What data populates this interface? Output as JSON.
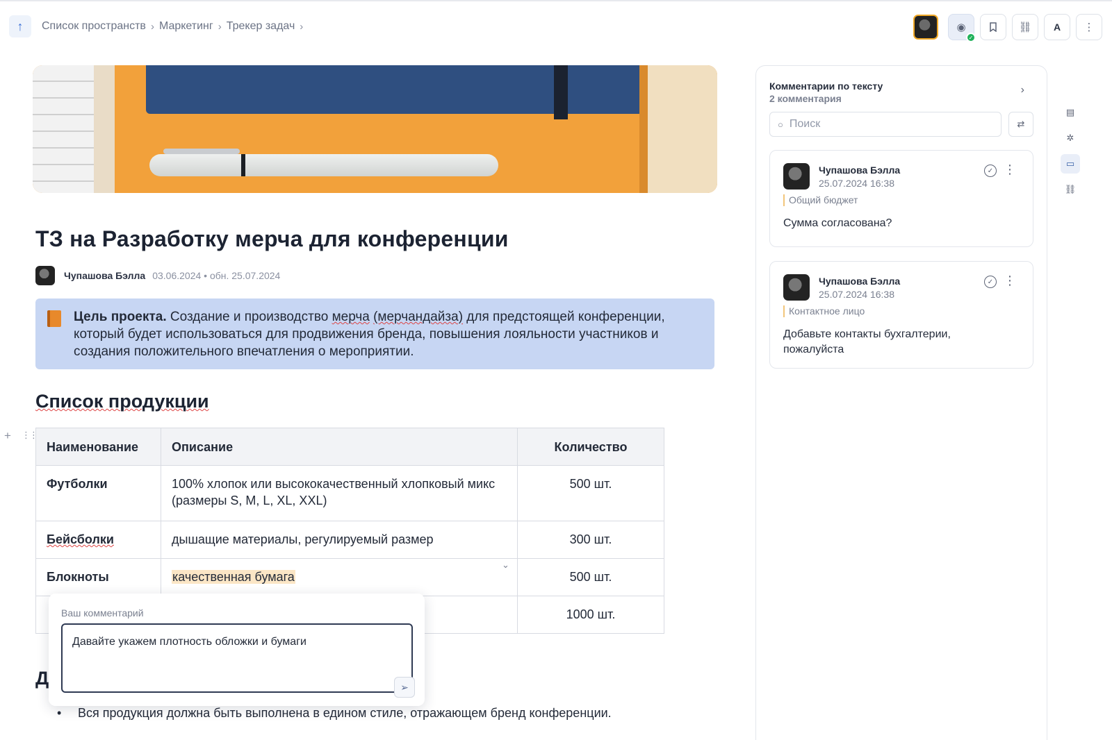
{
  "breadcrumb": {
    "items": [
      "Список пространств",
      "Маркетинг",
      "Трекер задач"
    ]
  },
  "header": {
    "font_label": "A"
  },
  "document": {
    "title": "ТЗ на Разработку мерча для конференции",
    "author": "Чупашова Бэлла",
    "dates": "03.06.2024 • обн. 25.07.2024",
    "callout": {
      "lead": "Цель проекта.",
      "text_1": " Создание и производство ",
      "text_w1": "мерча",
      "text_2": " ",
      "text_w2": "(мерчандайза)",
      "text_3": " для предстоящей конференции, который будет использоваться для продвижения бренда, повышения лояльности участников и создания положительного впечатления о мероприятии."
    },
    "section_title": "Список продукции",
    "table": {
      "headers": [
        "Наименование",
        "Описание",
        "Количество"
      ],
      "rows": [
        {
          "name": "Футболки",
          "desc": "100% хлопок или высококачественный хлопковый микс (размеры S, M, L, XL, XXL)",
          "qty": "500 шт."
        },
        {
          "name": "Бейсболки",
          "desc": "дышащие материалы, регулируемый размер",
          "qty": "300 шт."
        },
        {
          "name": "Блокноты",
          "desc": "качественная бумага",
          "qty": "500 шт."
        },
        {
          "name": "",
          "desc": "",
          "qty": "1000 шт."
        }
      ]
    },
    "section2_initial": "Д",
    "bullet": "Вся продукция должна быть выполнена в едином стиле, отражающем бренд конференции."
  },
  "comment_popup": {
    "label": "Ваш комментарий",
    "value": "Давайте укажем плотность обложки и бумаги"
  },
  "comments_panel": {
    "title": "Комментарии по тексту",
    "count": "2 комментария",
    "search_placeholder": "Поиск",
    "comments": [
      {
        "author": "Чупашова Бэлла",
        "date": "25.07.2024 16:38",
        "quote": "Общий бюджет",
        "text": "Сумма согласована?"
      },
      {
        "author": "Чупашова Бэлла",
        "date": "25.07.2024 16:38",
        "quote": "Контактное лицо",
        "text": "Добавьте контакты бухгалтерии, пожалуйста"
      }
    ]
  },
  "colors": {
    "accent": "#3b6fd6",
    "callout_bg": "#c7d6f3",
    "highlight": "#fbe6c6",
    "online": "#1fb15a"
  }
}
